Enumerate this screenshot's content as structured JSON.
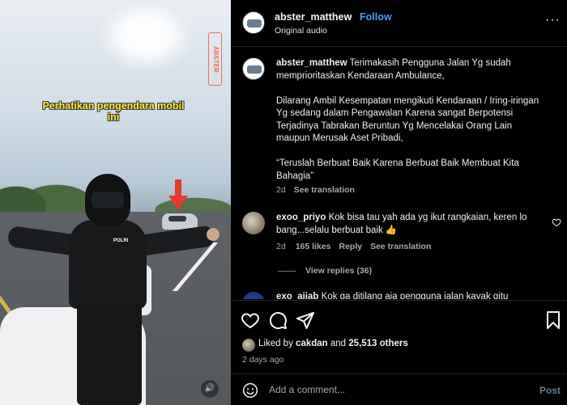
{
  "media": {
    "overlay_text": "Perhatikan pengendara mobil ini",
    "watermark": "ABSTER",
    "police_label": "POLRI",
    "audio_icon": "speaker-icon"
  },
  "header": {
    "username": "abster_matthew",
    "separator": "·",
    "follow_label": "Follow",
    "audio_label": "Original audio",
    "more_label": "···"
  },
  "caption": {
    "username": "abster_matthew",
    "paragraph_1": "Terimakasih Pengguna Jalan Yg sudah memprioritaskan Kendaraan Ambulance,",
    "paragraph_2": "Dilarang Ambil Kesempatan mengikuti Kendaraan / Iring-iringan Yg sedang dalam Pengawalan Karena sangat Berpotensi Terjadinya Tabrakan Beruntun Yg Mencelakai Orang Lain maupun Merusak Aset Pribadi,",
    "paragraph_3": "“Teruslah Berbuat Baik Karena Berbuat Baik Membuat Kita Bahagia”",
    "time": "2d",
    "translate_label": "See translation"
  },
  "comments": [
    {
      "username": "exoo_priyo",
      "text": "Kok bisa tau yah ada yg ikut rangkaian, keren lo bang...selalu berbuat baik 👍",
      "time": "2d",
      "likes": "165 likes",
      "reply_label": "Reply",
      "translate_label": "See translation",
      "view_replies": "View replies (36)"
    },
    {
      "username": "exo_aijab",
      "text": "Kok ga ditilang aja pengguna jalan kayak gitu"
    }
  ],
  "actions": {
    "liked_prefix": "Liked by",
    "liked_user": "cakdan",
    "liked_and": "and",
    "liked_count": "25,513 others",
    "posted_ago": "2 days ago"
  },
  "add_comment": {
    "placeholder": "Add a comment...",
    "post_label": "Post"
  },
  "colors": {
    "accent": "#4a9bf5",
    "overlay_yellow": "#ffeb3b",
    "watermark": "#ef6d5a",
    "muted": "#a8a8a8"
  }
}
